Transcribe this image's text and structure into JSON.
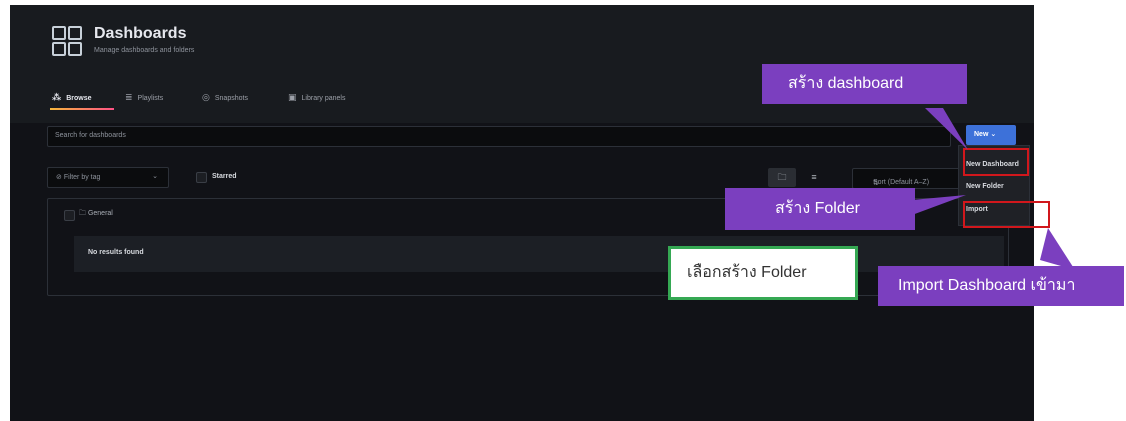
{
  "header": {
    "title": "Dashboards",
    "subtitle": "Manage dashboards and folders"
  },
  "tabs": [
    {
      "label": "Browse",
      "icon": "sitemap-icon",
      "active": true
    },
    {
      "label": "Playlists",
      "icon": "list-icon",
      "active": false
    },
    {
      "label": "Snapshots",
      "icon": "camera-icon",
      "active": false
    },
    {
      "label": "Library panels",
      "icon": "library-icon",
      "active": false
    }
  ],
  "search": {
    "placeholder": "Search for dashboards"
  },
  "new_button": {
    "label": "New ⌄"
  },
  "filter": {
    "label": "Filter by tag",
    "chevron": "⌄",
    "starred_label": "Starred"
  },
  "sort": {
    "label": "Sort (Default A–Z)",
    "icon": "⇅"
  },
  "folder": {
    "name": "General",
    "empty_text": "No results found"
  },
  "dropdown": {
    "items": [
      "New Dashboard",
      "New Folder",
      "Import"
    ]
  },
  "annotations": {
    "create_dashboard": "สร้าง dashboard",
    "create_folder": "สร้าง Folder",
    "choose_create_folder": "เลือกสร้าง Folder",
    "import_dashboard": "Import Dashboard เข้ามา"
  },
  "colors": {
    "background": "#111217",
    "header_bg": "#181b1f",
    "accent_blue": "#3d71d9",
    "annotation_purple": "#7b3fbf",
    "highlight_red": "#d1171c",
    "annotation_green": "#35a853"
  }
}
